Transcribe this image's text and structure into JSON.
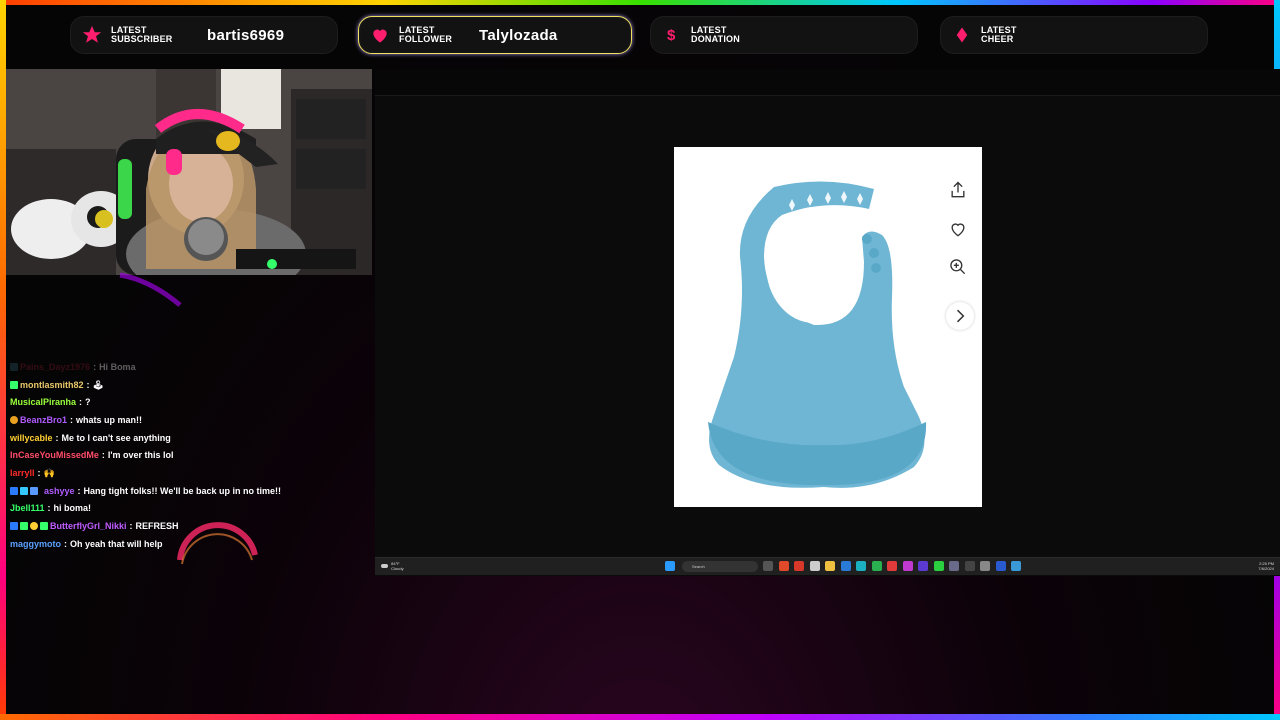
{
  "alerts": [
    {
      "label_line1": "LATEST",
      "label_line2": "SUBSCRIBER",
      "value": "bartis6969",
      "icon": "star-icon"
    },
    {
      "label_line1": "LATEST",
      "label_line2": "FOLLOWER",
      "value": "Talylozada",
      "icon": "heart-icon"
    },
    {
      "label_line1": "LATEST",
      "label_line2": "DONATION",
      "value": "",
      "icon": "dollar-icon"
    },
    {
      "label_line1": "LATEST",
      "label_line2": "CHEER",
      "value": "",
      "icon": "cheer-gem-icon"
    }
  ],
  "chat": {
    "messages": [
      {
        "user": "Pains_Dayz1976",
        "text": "Hi Boma",
        "color": "#8a1a2a",
        "faded": true
      },
      {
        "user": "montlasmith82",
        "text": "🕹",
        "color": "#e8c86a"
      },
      {
        "user": "MusicalPiranha",
        "text": "?",
        "color": "#9aff3c"
      },
      {
        "user": "BeanzBro1",
        "text": "whats up man!!",
        "color": "#b05cff"
      },
      {
        "user": "willycable",
        "text": "Me to I can't see anything",
        "color": "#ffcf33"
      },
      {
        "user": "InCaseYouMissedMe",
        "text": "I'm over this lol",
        "color": "#ff4d6a"
      },
      {
        "user": "larryll",
        "text": "🙌",
        "color": "#ff2a2a"
      },
      {
        "user": "ashyye",
        "text": "Hang tight folks!! We'll be back up in no time!!",
        "color": "#b05cff"
      },
      {
        "user": "Jbell111",
        "text": "hi boma!",
        "color": "#35ff6a"
      },
      {
        "user": "ButterflyGrl_Nikki",
        "text": "REFRESH",
        "color": "#c05cff"
      },
      {
        "user": "maggymoto",
        "text": "Oh yeah that will help",
        "color": "#5aa0ff"
      }
    ]
  },
  "product": {
    "buttons": [
      "share-icon",
      "heart-outline-icon",
      "zoom-in-icon",
      "chevron-right-icon"
    ],
    "accent": "#6fb6d4"
  },
  "taskbar": {
    "weather_temp": "84°F",
    "weather_desc": "Cloudy",
    "search_placeholder": "Search",
    "time": "2:25 PM",
    "date": "7/6/2024"
  }
}
